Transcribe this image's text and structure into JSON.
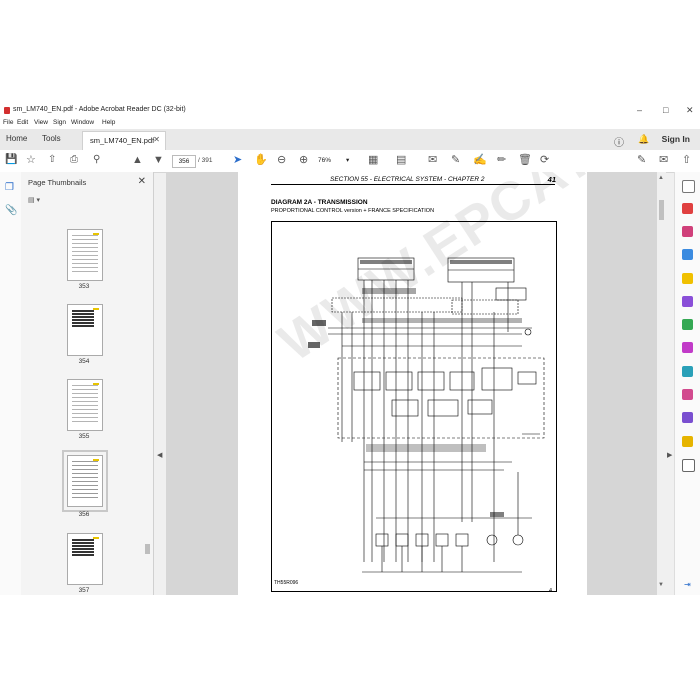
{
  "window": {
    "title": "sm_LM740_EN.pdf - Adobe Acrobat Reader DC (32-bit)"
  },
  "menu": [
    "File",
    "Edit",
    "View",
    "Sign",
    "Window",
    "Help"
  ],
  "tabs": {
    "home": "Home",
    "tools": "Tools",
    "document": "sm_LM740_EN.pdf"
  },
  "signin": "Sign In",
  "toolbar": {
    "page_current": "356",
    "page_total": "/ 391",
    "zoom": "76%"
  },
  "thumbnails": {
    "header": "Page Thumbnails",
    "pages": [
      "353",
      "354",
      "355",
      "356",
      "357"
    ],
    "selected": "356"
  },
  "page": {
    "section_header": "SECTION 55 - ELECTRICAL SYSTEM - CHAPTER 2",
    "page_number": "41",
    "diagram_title": "DIAGRAM 2A - TRANSMISSION",
    "diagram_subtitle": "PROPORTIONAL CONTROL version + FRANCE SPECIFICATION",
    "figure_code": "TH55R096",
    "footer_number": "4"
  },
  "watermark": "WWW.EPCATSPRO.COM",
  "colors": {
    "accent": "#2c6ecb",
    "pdf_red": "#d32f2f"
  }
}
